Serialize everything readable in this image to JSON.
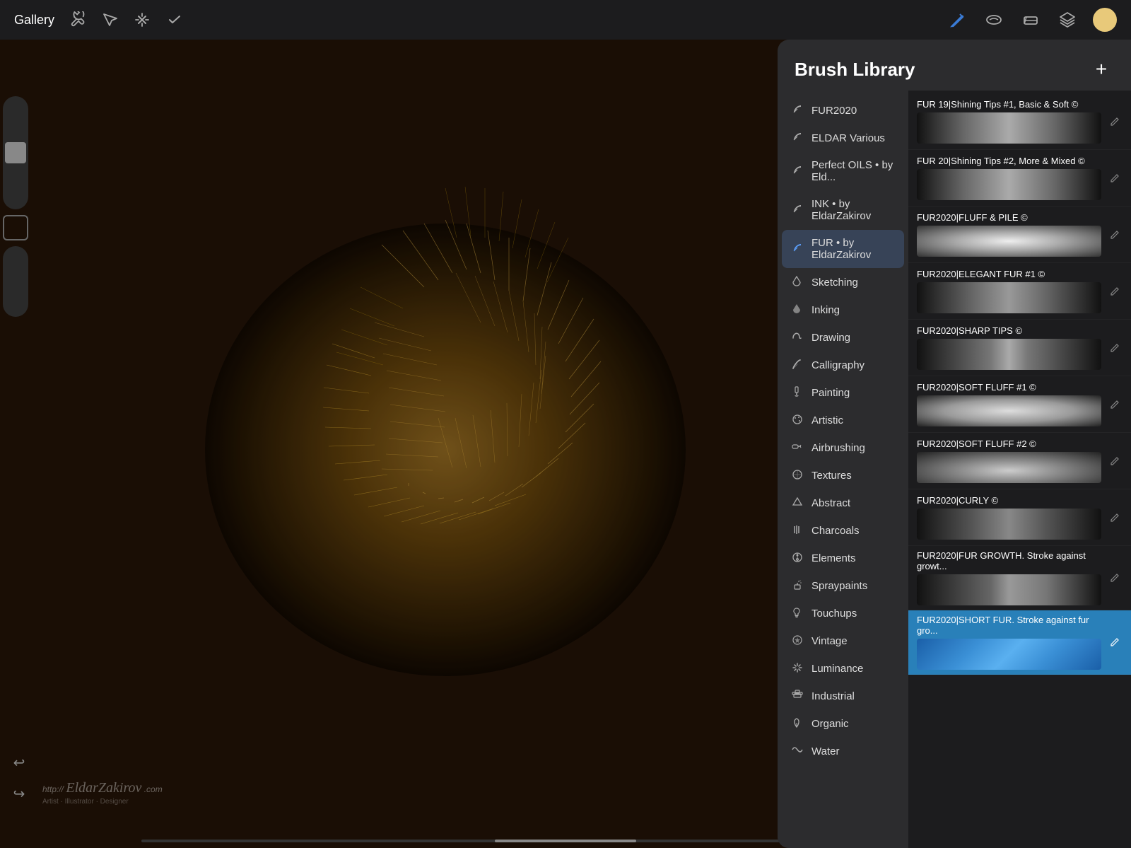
{
  "toolbar": {
    "gallery_label": "Gallery",
    "tools": [
      {
        "name": "wrench",
        "icon": "⚙",
        "label": "wrench-icon",
        "active": false
      },
      {
        "name": "selection",
        "icon": "✳",
        "label": "selection-icon",
        "active": false
      },
      {
        "name": "transform",
        "icon": "S",
        "label": "transform-icon",
        "active": false
      },
      {
        "name": "actions",
        "icon": "✈",
        "label": "actions-icon",
        "active": false
      }
    ],
    "right_tools": [
      {
        "name": "draw",
        "active": true
      },
      {
        "name": "smudge",
        "active": false
      },
      {
        "name": "erase",
        "active": false
      },
      {
        "name": "layers",
        "active": false
      }
    ]
  },
  "brush_library": {
    "title": "Brush Library",
    "add_button": "+",
    "categories": [
      {
        "id": "fur2020",
        "name": "FUR2020",
        "icon": "feather"
      },
      {
        "id": "eldar-various",
        "name": "ELDAR Various",
        "icon": "feather"
      },
      {
        "id": "perfect-oils",
        "name": "Perfect OILS • by Eld...",
        "icon": "feather"
      },
      {
        "id": "ink",
        "name": "INK • by EldarZakirov",
        "icon": "feather"
      },
      {
        "id": "fur-eldar",
        "name": "FUR • by EldarZakirov",
        "icon": "feather-blue",
        "active": true
      },
      {
        "id": "sketching",
        "name": "Sketching",
        "icon": "drop"
      },
      {
        "id": "inking",
        "name": "Inking",
        "icon": "ink-drop"
      },
      {
        "id": "drawing",
        "name": "Drawing",
        "icon": "loop"
      },
      {
        "id": "calligraphy",
        "name": "Calligraphy",
        "icon": "calligraphy"
      },
      {
        "id": "painting",
        "name": "Painting",
        "icon": "brush"
      },
      {
        "id": "artistic",
        "name": "Artistic",
        "icon": "palette"
      },
      {
        "id": "airbrushing",
        "name": "Airbrushing",
        "icon": "airbrush"
      },
      {
        "id": "textures",
        "name": "Textures",
        "icon": "texture"
      },
      {
        "id": "abstract",
        "name": "Abstract",
        "icon": "triangle"
      },
      {
        "id": "charcoals",
        "name": "Charcoals",
        "icon": "lines"
      },
      {
        "id": "elements",
        "name": "Elements",
        "icon": "yin-yang"
      },
      {
        "id": "spraypaints",
        "name": "Spraypaints",
        "icon": "spray"
      },
      {
        "id": "touchups",
        "name": "Touchups",
        "icon": "bulb"
      },
      {
        "id": "vintage",
        "name": "Vintage",
        "icon": "star-circle"
      },
      {
        "id": "luminance",
        "name": "Luminance",
        "icon": "sparkle"
      },
      {
        "id": "industrial",
        "name": "Industrial",
        "icon": "anvil"
      },
      {
        "id": "organic",
        "name": "Organic",
        "icon": "leaf"
      },
      {
        "id": "water",
        "name": "Water",
        "icon": "wave"
      }
    ],
    "brushes": [
      {
        "id": "fur19",
        "name": "FUR 19|Shining Tips #1, Basic & Soft ©",
        "stroke_class": "stroke-fur19",
        "selected": false
      },
      {
        "id": "fur20",
        "name": "FUR 20|Shining Tips #2, More & Mixed ©",
        "stroke_class": "stroke-fur20",
        "selected": false
      },
      {
        "id": "fluff",
        "name": "FUR2020|FLUFF & PILE ©",
        "stroke_class": "stroke-fluff",
        "selected": false
      },
      {
        "id": "elegant",
        "name": "FUR2020|ELEGANT FUR #1 ©",
        "stroke_class": "stroke-elegant",
        "selected": false
      },
      {
        "id": "sharp",
        "name": "FUR2020|SHARP TIPS ©",
        "stroke_class": "stroke-sharp",
        "selected": false
      },
      {
        "id": "soft1",
        "name": "FUR2020|SOFT FLUFF #1 ©",
        "stroke_class": "stroke-soft1",
        "selected": false
      },
      {
        "id": "soft2",
        "name": "FUR2020|SOFT FLUFF #2 ©",
        "stroke_class": "stroke-soft2",
        "selected": false
      },
      {
        "id": "curly",
        "name": "FUR2020|CURLY ©",
        "stroke_class": "stroke-curly",
        "selected": false
      },
      {
        "id": "growth",
        "name": "FUR2020|FUR GROWTH. Stroke against growt...",
        "stroke_class": "stroke-growth",
        "selected": false
      },
      {
        "id": "short",
        "name": "FUR2020|SHORT FUR. Stroke against fur gro...",
        "stroke_class": "stroke-short",
        "selected": true
      }
    ]
  },
  "watermark": {
    "url": "http://",
    "name": "EldarZakirov.com",
    "subtitle": "Artist · Illustrator · Designer"
  },
  "left_panel": {
    "undo_label": "↩",
    "redo_label": "↪"
  }
}
